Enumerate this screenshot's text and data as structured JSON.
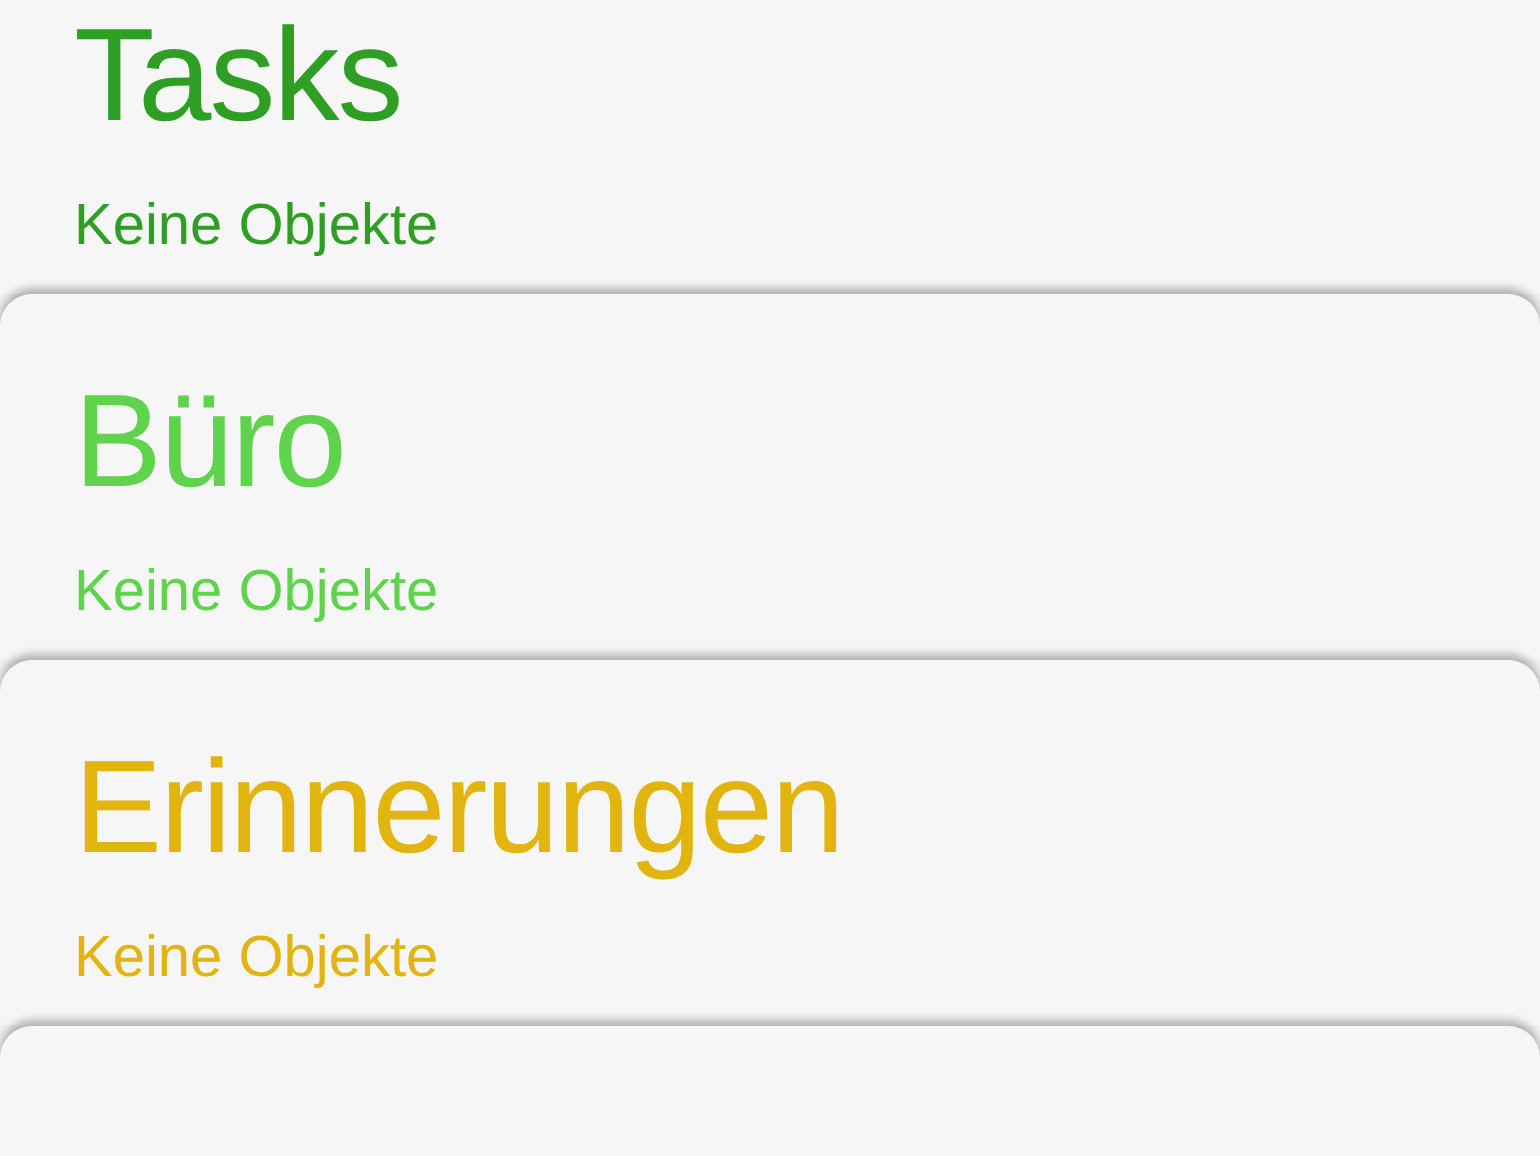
{
  "lists": [
    {
      "title": "Tasks",
      "subtitle": "Keine Objekte",
      "color": "#2f9e24"
    },
    {
      "title": "Büro",
      "subtitle": "Keine Objekte",
      "color": "#5ed34b"
    },
    {
      "title": "Erinnerungen",
      "subtitle": "Keine Objekte",
      "color": "#e2b40f"
    }
  ]
}
